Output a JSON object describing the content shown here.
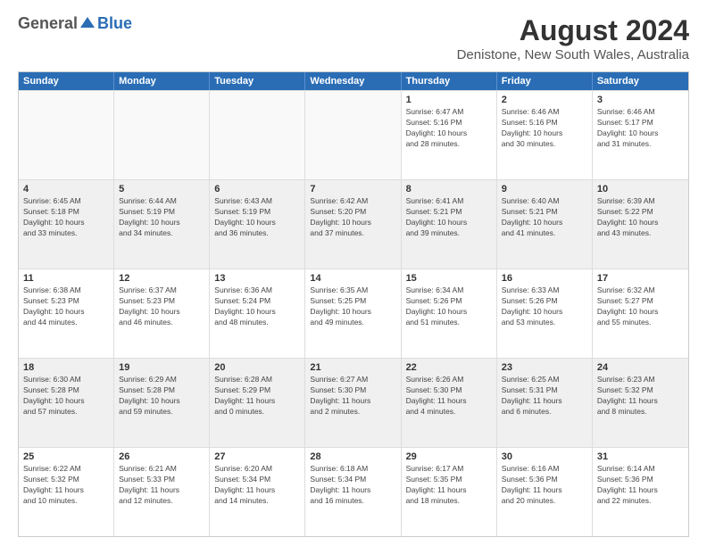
{
  "logo": {
    "general": "General",
    "blue": "Blue"
  },
  "title": "August 2024",
  "subtitle": "Denistone, New South Wales, Australia",
  "header": {
    "days": [
      "Sunday",
      "Monday",
      "Tuesday",
      "Wednesday",
      "Thursday",
      "Friday",
      "Saturday"
    ]
  },
  "rows": [
    [
      {
        "day": "",
        "info": "",
        "empty": true
      },
      {
        "day": "",
        "info": "",
        "empty": true
      },
      {
        "day": "",
        "info": "",
        "empty": true
      },
      {
        "day": "",
        "info": "",
        "empty": true
      },
      {
        "day": "1",
        "info": "Sunrise: 6:47 AM\nSunset: 5:16 PM\nDaylight: 10 hours\nand 28 minutes."
      },
      {
        "day": "2",
        "info": "Sunrise: 6:46 AM\nSunset: 5:16 PM\nDaylight: 10 hours\nand 30 minutes."
      },
      {
        "day": "3",
        "info": "Sunrise: 6:46 AM\nSunset: 5:17 PM\nDaylight: 10 hours\nand 31 minutes."
      }
    ],
    [
      {
        "day": "4",
        "info": "Sunrise: 6:45 AM\nSunset: 5:18 PM\nDaylight: 10 hours\nand 33 minutes.",
        "shaded": true
      },
      {
        "day": "5",
        "info": "Sunrise: 6:44 AM\nSunset: 5:19 PM\nDaylight: 10 hours\nand 34 minutes.",
        "shaded": true
      },
      {
        "day": "6",
        "info": "Sunrise: 6:43 AM\nSunset: 5:19 PM\nDaylight: 10 hours\nand 36 minutes.",
        "shaded": true
      },
      {
        "day": "7",
        "info": "Sunrise: 6:42 AM\nSunset: 5:20 PM\nDaylight: 10 hours\nand 37 minutes.",
        "shaded": true
      },
      {
        "day": "8",
        "info": "Sunrise: 6:41 AM\nSunset: 5:21 PM\nDaylight: 10 hours\nand 39 minutes.",
        "shaded": true
      },
      {
        "day": "9",
        "info": "Sunrise: 6:40 AM\nSunset: 5:21 PM\nDaylight: 10 hours\nand 41 minutes.",
        "shaded": true
      },
      {
        "day": "10",
        "info": "Sunrise: 6:39 AM\nSunset: 5:22 PM\nDaylight: 10 hours\nand 43 minutes.",
        "shaded": true
      }
    ],
    [
      {
        "day": "11",
        "info": "Sunrise: 6:38 AM\nSunset: 5:23 PM\nDaylight: 10 hours\nand 44 minutes."
      },
      {
        "day": "12",
        "info": "Sunrise: 6:37 AM\nSunset: 5:23 PM\nDaylight: 10 hours\nand 46 minutes."
      },
      {
        "day": "13",
        "info": "Sunrise: 6:36 AM\nSunset: 5:24 PM\nDaylight: 10 hours\nand 48 minutes."
      },
      {
        "day": "14",
        "info": "Sunrise: 6:35 AM\nSunset: 5:25 PM\nDaylight: 10 hours\nand 49 minutes."
      },
      {
        "day": "15",
        "info": "Sunrise: 6:34 AM\nSunset: 5:26 PM\nDaylight: 10 hours\nand 51 minutes."
      },
      {
        "day": "16",
        "info": "Sunrise: 6:33 AM\nSunset: 5:26 PM\nDaylight: 10 hours\nand 53 minutes."
      },
      {
        "day": "17",
        "info": "Sunrise: 6:32 AM\nSunset: 5:27 PM\nDaylight: 10 hours\nand 55 minutes."
      }
    ],
    [
      {
        "day": "18",
        "info": "Sunrise: 6:30 AM\nSunset: 5:28 PM\nDaylight: 10 hours\nand 57 minutes.",
        "shaded": true
      },
      {
        "day": "19",
        "info": "Sunrise: 6:29 AM\nSunset: 5:28 PM\nDaylight: 10 hours\nand 59 minutes.",
        "shaded": true
      },
      {
        "day": "20",
        "info": "Sunrise: 6:28 AM\nSunset: 5:29 PM\nDaylight: 11 hours\nand 0 minutes.",
        "shaded": true
      },
      {
        "day": "21",
        "info": "Sunrise: 6:27 AM\nSunset: 5:30 PM\nDaylight: 11 hours\nand 2 minutes.",
        "shaded": true
      },
      {
        "day": "22",
        "info": "Sunrise: 6:26 AM\nSunset: 5:30 PM\nDaylight: 11 hours\nand 4 minutes.",
        "shaded": true
      },
      {
        "day": "23",
        "info": "Sunrise: 6:25 AM\nSunset: 5:31 PM\nDaylight: 11 hours\nand 6 minutes.",
        "shaded": true
      },
      {
        "day": "24",
        "info": "Sunrise: 6:23 AM\nSunset: 5:32 PM\nDaylight: 11 hours\nand 8 minutes.",
        "shaded": true
      }
    ],
    [
      {
        "day": "25",
        "info": "Sunrise: 6:22 AM\nSunset: 5:32 PM\nDaylight: 11 hours\nand 10 minutes."
      },
      {
        "day": "26",
        "info": "Sunrise: 6:21 AM\nSunset: 5:33 PM\nDaylight: 11 hours\nand 12 minutes."
      },
      {
        "day": "27",
        "info": "Sunrise: 6:20 AM\nSunset: 5:34 PM\nDaylight: 11 hours\nand 14 minutes."
      },
      {
        "day": "28",
        "info": "Sunrise: 6:18 AM\nSunset: 5:34 PM\nDaylight: 11 hours\nand 16 minutes."
      },
      {
        "day": "29",
        "info": "Sunrise: 6:17 AM\nSunset: 5:35 PM\nDaylight: 11 hours\nand 18 minutes."
      },
      {
        "day": "30",
        "info": "Sunrise: 6:16 AM\nSunset: 5:36 PM\nDaylight: 11 hours\nand 20 minutes."
      },
      {
        "day": "31",
        "info": "Sunrise: 6:14 AM\nSunset: 5:36 PM\nDaylight: 11 hours\nand 22 minutes."
      }
    ]
  ]
}
